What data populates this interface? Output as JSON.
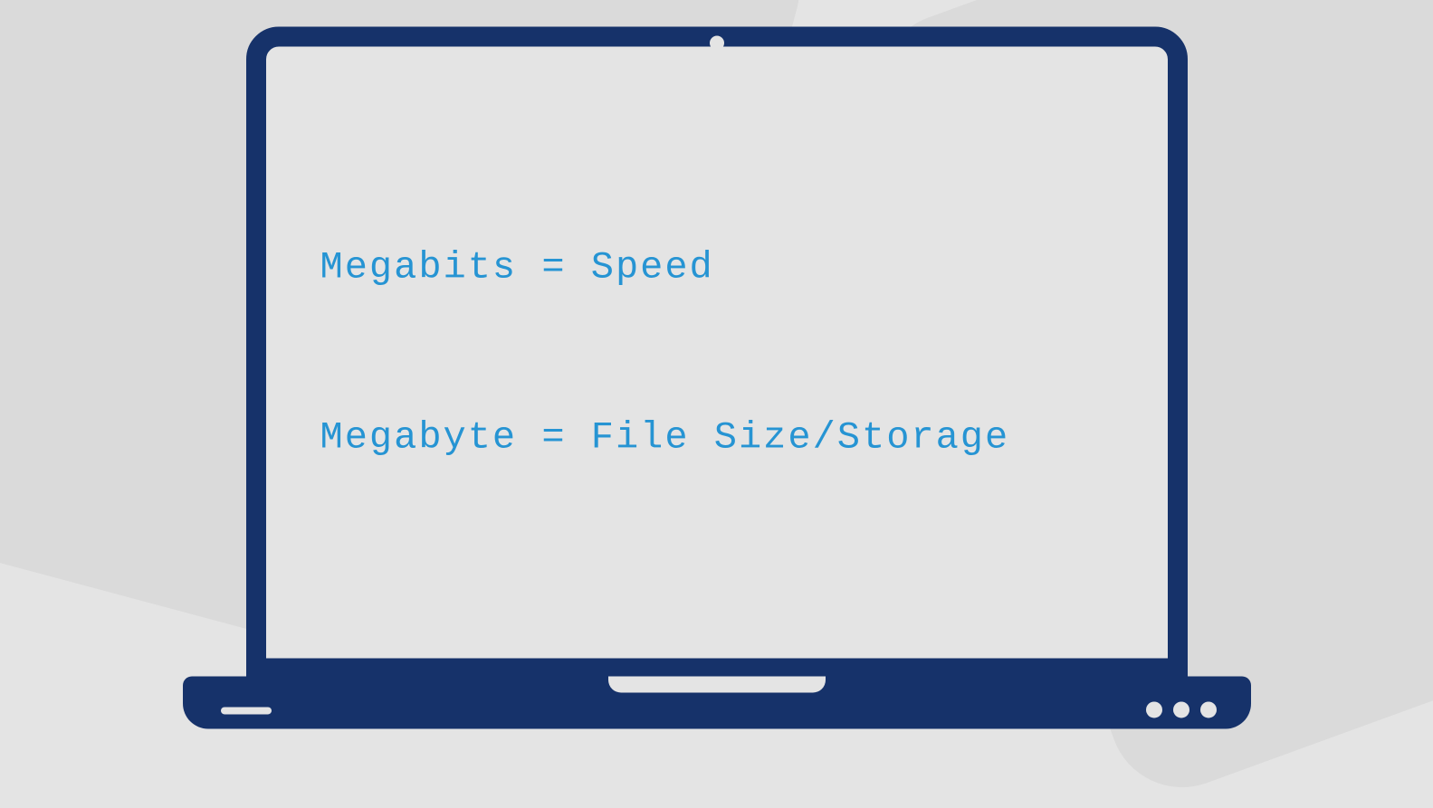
{
  "screen": {
    "line1": "Megabits = Speed",
    "line2": "Megabyte = File Size/Storage"
  }
}
